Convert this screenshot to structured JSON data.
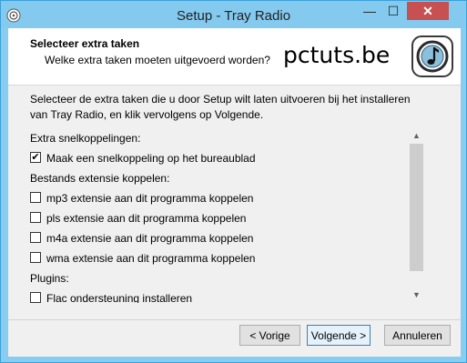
{
  "window": {
    "title": "Setup - Tray Radio"
  },
  "header": {
    "title": "Selecteer extra taken",
    "subtitle": "Welke extra taken moeten uitgevoerd worden?",
    "brand": "pctuts.be"
  },
  "intro": "Selecteer de extra taken die u door Setup wilt laten uitvoeren bij het installeren van Tray Radio, en klik vervolgens op Volgende.",
  "groups": [
    {
      "heading": "Extra snelkoppelingen:"
    },
    {
      "heading": "Bestands extensie koppelen:"
    },
    {
      "heading": "Plugins:"
    }
  ],
  "tasks": [
    {
      "label": "Maak een snelkoppeling op het bureaublad",
      "checked": true,
      "mark": "✔"
    },
    {
      "label": "mp3 extensie aan dit programma koppelen",
      "checked": false
    },
    {
      "label": "pls extensie aan dit programma koppelen",
      "checked": false
    },
    {
      "label": "m4a extensie aan dit programma koppelen",
      "checked": false
    },
    {
      "label": "wma extensie aan dit programma koppelen",
      "checked": false
    },
    {
      "label": "Flac ondersteuning installeren",
      "checked": false
    }
  ],
  "buttons": {
    "back": "< Vorige",
    "next": "Volgende >",
    "cancel": "Annuleren"
  },
  "titlebar_buttons": {
    "minimize": "—",
    "maximize": "☐",
    "close": "✕"
  },
  "colors": {
    "frame": "#88cdf0",
    "close": "#c75050",
    "default_button": "#3c7fb1"
  }
}
